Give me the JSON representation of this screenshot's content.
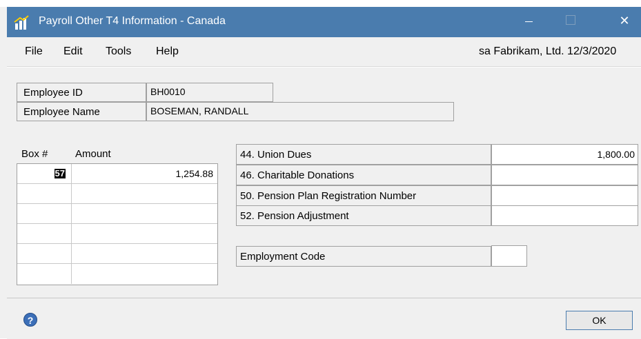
{
  "window": {
    "title": "Payroll Other T4 Information - Canada",
    "close_glyph": "✕"
  },
  "menu": [
    "File",
    "Edit",
    "Tools",
    "Help"
  ],
  "status": "sa  Fabrikam, Ltd.  12/3/2020",
  "employee": {
    "id_label": "Employee ID",
    "id_value": "BH0010",
    "name_label": "Employee Name",
    "name_value": "BOSEMAN, RANDALL"
  },
  "grid": {
    "col_box": "Box #",
    "col_amount": "Amount",
    "rows": [
      {
        "box": "57",
        "amount": "1,254.88"
      },
      {
        "box": "",
        "amount": ""
      },
      {
        "box": "",
        "amount": ""
      },
      {
        "box": "",
        "amount": ""
      },
      {
        "box": "",
        "amount": ""
      },
      {
        "box": "",
        "amount": ""
      }
    ]
  },
  "fields": {
    "union_dues_label": "44. Union Dues",
    "union_dues_value": "1,800.00",
    "charitable_label": "46. Charitable Donations",
    "charitable_value": "",
    "pension_reg_label": "50. Pension Plan Registration Number",
    "pension_reg_value": "",
    "pension_adj_label": "52. Pension Adjustment",
    "pension_adj_value": "",
    "employment_code_label": "Employment Code",
    "employment_code_value": ""
  },
  "footer": {
    "help_glyph": "?",
    "ok_label": "OK"
  },
  "colors": {
    "titlebar": "#4a7cae",
    "background": "#f0f0f0"
  }
}
